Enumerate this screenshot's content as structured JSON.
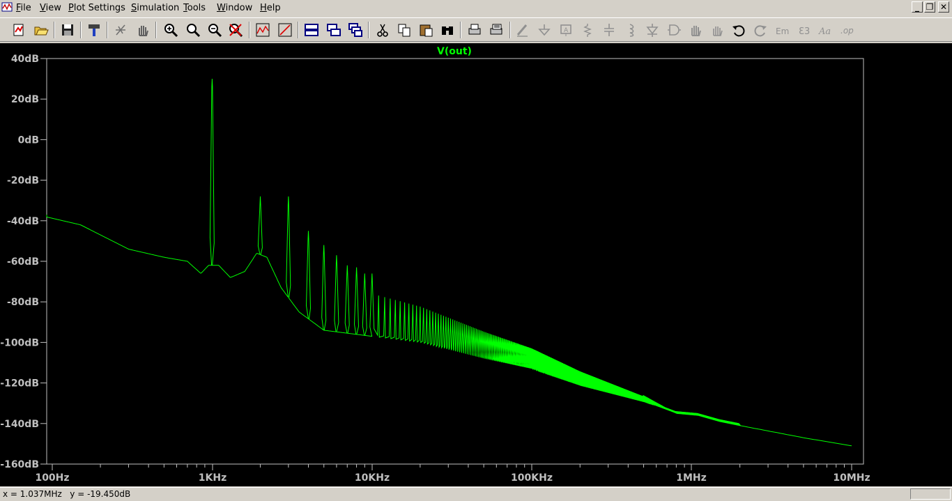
{
  "menu": {
    "items": [
      {
        "label": "File",
        "hotkey": "F"
      },
      {
        "label": "View",
        "hotkey": "V"
      },
      {
        "label": "Plot Settings",
        "hotkey": "P"
      },
      {
        "label": "Simulation",
        "hotkey": "S"
      },
      {
        "label": "Tools",
        "hotkey": "T"
      },
      {
        "label": "Window",
        "hotkey": "W"
      },
      {
        "label": "Help",
        "hotkey": "H"
      }
    ]
  },
  "window_controls": {
    "minimize": "_",
    "restore": "❐",
    "close": "✕"
  },
  "toolbar": {
    "icons": [
      "new-schematic-icon",
      "open-folder-icon",
      "save-icon",
      "control-panel-hammer-icon",
      "run-simulation-icon",
      "halt-hand-icon",
      "zoom-in-icon",
      "zoom-out-icon",
      "zoom-full-icon",
      "cancel-zoom-icon",
      "autorange-icon",
      "plot-settings-icon",
      "tile-horizontal-icon",
      "tile-vertical-icon",
      "cascade-windows-icon",
      "cut-icon",
      "copy-icon",
      "paste-icon",
      "find-icon",
      "print-icon",
      "print-setup-icon",
      "draw-wire-icon",
      "ground-icon",
      "label-net-icon",
      "resistor-icon",
      "capacitor-icon",
      "inductor-icon",
      "diode-icon",
      "component-icon",
      "move-icon",
      "drag-icon",
      "undo-icon",
      "redo-icon",
      "rotate-icon",
      "mirror-icon",
      "text-icon",
      "spice-directive-icon"
    ]
  },
  "plot": {
    "trace_name": "V(out)",
    "trace_color": "#00ff00",
    "axis_color": "#bfbfbf",
    "background": "#000000"
  },
  "chart_data": {
    "type": "line",
    "title": "V(out)",
    "xlabel": "",
    "ylabel": "",
    "xscale": "log",
    "xlim": [
      100,
      10000000
    ],
    "ylim": [
      -160,
      40
    ],
    "x_tick_labels": [
      "100Hz",
      "1KHz",
      "10KHz",
      "100KHz",
      "1MHz",
      "10MHz"
    ],
    "y_tick_labels": [
      "40dB",
      "20dB",
      "0dB",
      "-20dB",
      "-40dB",
      "-60dB",
      "-80dB",
      "-100dB",
      "-120dB",
      "-140dB",
      "-160dB"
    ],
    "grid": false,
    "series": [
      {
        "name": "V(out)",
        "noise_floor": [
          [
            80,
            -37
          ],
          [
            150,
            -42
          ],
          [
            300,
            -54
          ],
          [
            500,
            -58
          ],
          [
            700,
            -60
          ],
          [
            850,
            -66
          ],
          [
            950,
            -62
          ],
          [
            1100,
            -62
          ],
          [
            1300,
            -68
          ],
          [
            1600,
            -65
          ],
          [
            1900,
            -56
          ],
          [
            2200,
            -58
          ],
          [
            2700,
            -73
          ],
          [
            3500,
            -85
          ],
          [
            5000,
            -94
          ],
          [
            10000,
            -97
          ],
          [
            20000,
            -100
          ],
          [
            50000,
            -108
          ],
          [
            100000,
            -113
          ],
          [
            200000,
            -121
          ],
          [
            500000,
            -129
          ],
          [
            800000,
            -135
          ],
          [
            1100000,
            -136
          ],
          [
            1500000,
            -139
          ],
          [
            2000000,
            -141
          ],
          [
            5000000,
            -147
          ],
          [
            10000000,
            -151
          ]
        ],
        "peaks": [
          [
            1000,
            30
          ],
          [
            2000,
            -28
          ],
          [
            3000,
            -28
          ],
          [
            4000,
            -45
          ],
          [
            5000,
            -52
          ],
          [
            6000,
            -57
          ],
          [
            7000,
            -62
          ],
          [
            8000,
            -63
          ],
          [
            9000,
            -66
          ],
          [
            10000,
            -66
          ]
        ]
      }
    ]
  },
  "status": {
    "x_readout": "x = 1.037MHz",
    "y_readout": "y = -19.450dB"
  }
}
